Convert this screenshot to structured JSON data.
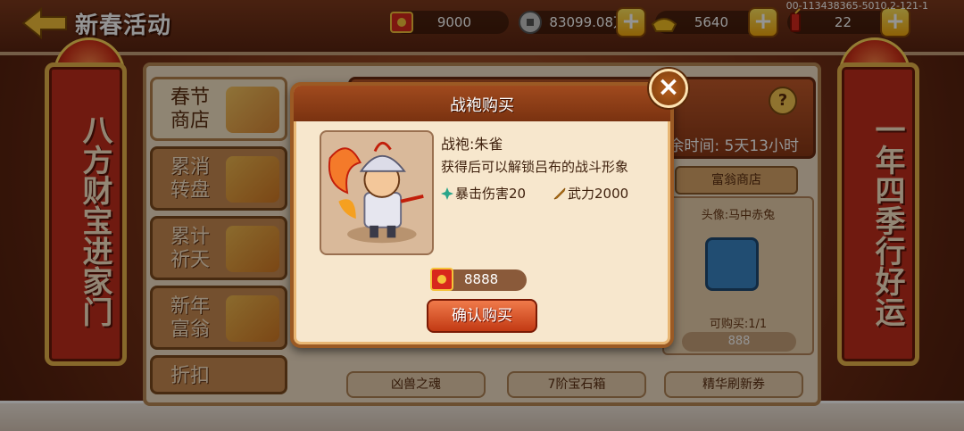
{
  "header": {
    "title": "新春活动",
    "build_id": "00-113438365-5010.2-121-1"
  },
  "resources": [
    {
      "value": "9000",
      "icon": "red-envelope-icon"
    },
    {
      "value": "83099.08万",
      "icon": "coin-icon"
    },
    {
      "value": "5640",
      "icon": "gold-ingot-icon"
    },
    {
      "value": "22",
      "icon": "firecracker-icon"
    }
  ],
  "couplets": {
    "left": "八方财宝进家门",
    "right": "一年四季行好运"
  },
  "tabs": [
    {
      "label": "春节商店",
      "active": true
    },
    {
      "label": "累消转盘",
      "active": false
    },
    {
      "label": "累计祈天",
      "active": false
    },
    {
      "label": "新年富翁",
      "active": false
    },
    {
      "label": "折扣",
      "active": false
    }
  ],
  "banner": {
    "remaining": "余时间: 5天13小时",
    "help": "?"
  },
  "shop": {
    "tab_label": "富翁商店",
    "item_name": "头像:马中赤兔",
    "item_icon": "scroll-icon",
    "limit": "可购买:1/1",
    "price": "888",
    "bottom_buttons": [
      "凶兽之魂",
      "7阶宝石箱",
      "精华刷新券"
    ]
  },
  "modal": {
    "title": "战袍购买",
    "item_name": "战袍:朱雀",
    "description": "获得后可以解锁吕布的战斗形象",
    "stats": [
      {
        "text": "暴击伤害20",
        "icon": "crit-icon",
        "color": "#2aa58a"
      },
      {
        "text": "武力2000",
        "icon": "sword-icon",
        "color": "#e69a2a"
      }
    ],
    "price": "8888",
    "price_icon": "red-envelope-icon",
    "confirm_label": "确认购买",
    "close_label": "×"
  }
}
